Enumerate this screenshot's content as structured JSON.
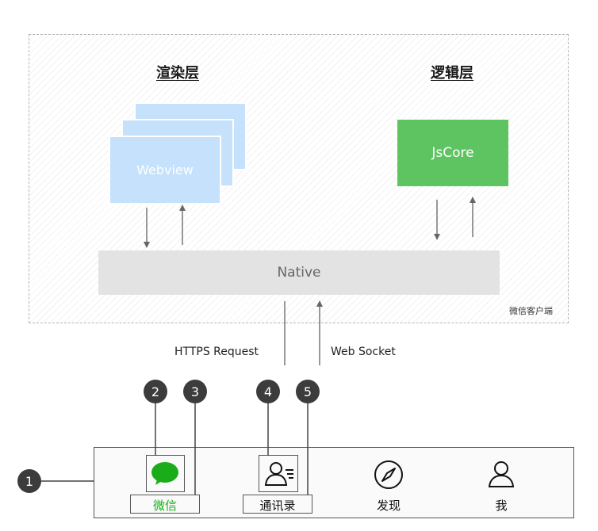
{
  "client": {
    "label": "微信客户端"
  },
  "render_layer": {
    "title": "渲染层",
    "webview_label": "Webview"
  },
  "logic_layer": {
    "title": "逻辑层",
    "jscore_label": "JsCore"
  },
  "native": {
    "label": "Native"
  },
  "connections": {
    "https": "HTTPS Request",
    "websocket": "Web Socket"
  },
  "badges": [
    "1",
    "2",
    "3",
    "4",
    "5"
  ],
  "tabs": [
    {
      "label": "微信",
      "icon": "chat-bubble-icon",
      "color": "#1aad19"
    },
    {
      "label": "通讯录",
      "icon": "contacts-icon",
      "color": "#111111"
    },
    {
      "label": "发现",
      "icon": "compass-icon",
      "color": "#111111"
    },
    {
      "label": "我",
      "icon": "person-icon",
      "color": "#111111"
    }
  ],
  "colors": {
    "webview": "#c5e1fb",
    "jscore": "#5ec462",
    "native": "#e3e3e3",
    "badge": "#3c3c3c",
    "wechat_green": "#1aad19"
  }
}
